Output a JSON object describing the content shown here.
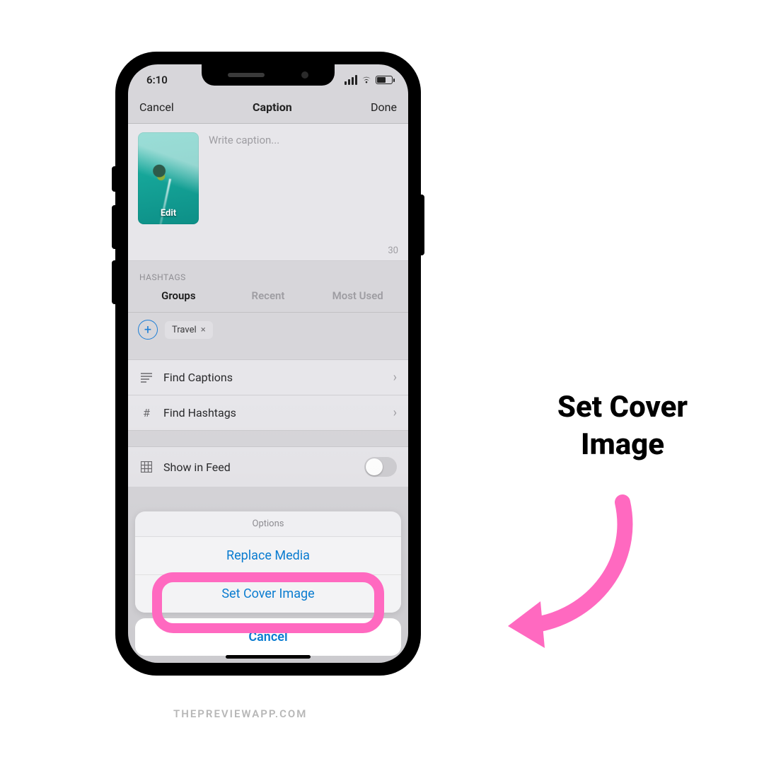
{
  "statusbar": {
    "time": "6:10"
  },
  "nav": {
    "cancel": "Cancel",
    "title": "Caption",
    "done": "Done"
  },
  "caption": {
    "placeholder": "Write caption...",
    "edit_label": "Edit",
    "counter": "30"
  },
  "hashtags": {
    "section_label": "HASHTAGS",
    "tabs": {
      "groups": "Groups",
      "recent": "Recent",
      "most_used": "Most Used"
    },
    "chip": {
      "label": "Travel",
      "close": "×"
    }
  },
  "rows": {
    "find_captions": "Find Captions",
    "find_hashtags": "Find Hashtags",
    "show_in_feed": "Show in Feed"
  },
  "sheet": {
    "title": "Options",
    "replace": "Replace Media",
    "set_cover": "Set Cover Image",
    "cancel": "Cancel"
  },
  "annotation": {
    "line1": "Set Cover",
    "line2": "Image"
  },
  "watermark": "THEPREVIEWAPP.COM",
  "colors": {
    "pink": "#ff69c0",
    "ios_blue": "#0a7cd0"
  }
}
